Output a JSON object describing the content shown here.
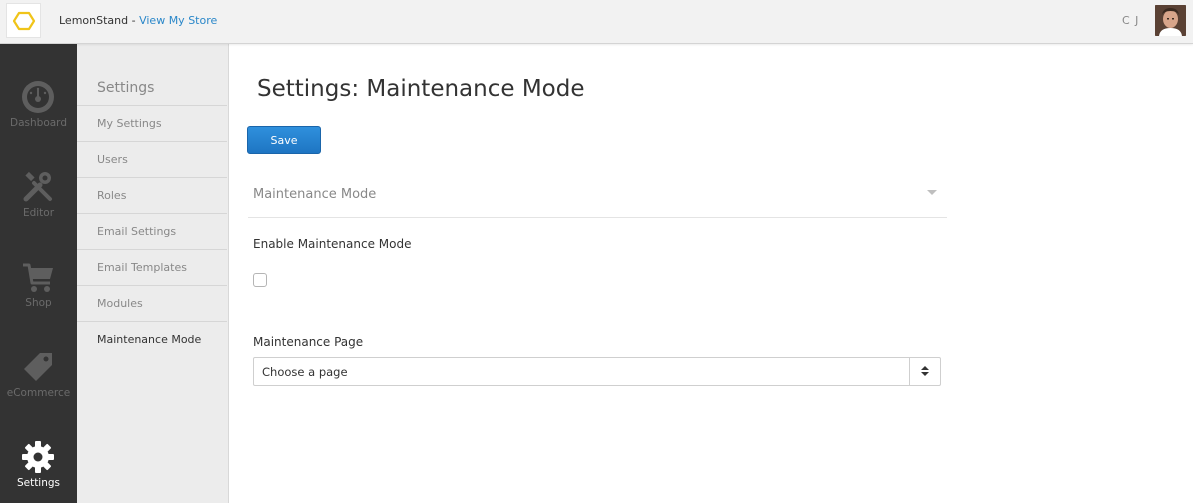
{
  "app": {
    "brand_name": "LemonStand",
    "brand_separator": " - ",
    "store_link": "View My Store",
    "user_initials": "C J",
    "accent_color": "#2a87c9",
    "logo_color": "#f0c419"
  },
  "left_nav": {
    "items": [
      {
        "label": "Dashboard",
        "icon": "speedometer-icon",
        "active": false
      },
      {
        "label": "Editor",
        "icon": "tools-icon",
        "active": false
      },
      {
        "label": "Shop",
        "icon": "cart-icon",
        "active": false
      },
      {
        "label": "eCommerce",
        "icon": "tag-icon",
        "active": false
      },
      {
        "label": "Settings",
        "icon": "gear-icon",
        "active": true
      }
    ]
  },
  "settings_nav": {
    "title": "Settings",
    "items": [
      {
        "label": "My Settings",
        "active": false
      },
      {
        "label": "Users",
        "active": false
      },
      {
        "label": "Roles",
        "active": false
      },
      {
        "label": "Email Settings",
        "active": false
      },
      {
        "label": "Email Templates",
        "active": false
      },
      {
        "label": "Modules",
        "active": false
      },
      {
        "label": "Maintenance Mode",
        "active": true
      }
    ]
  },
  "main": {
    "title": "Settings: Maintenance Mode",
    "save_label": "Save",
    "section_title": "Maintenance Mode",
    "enable_label": "Enable Maintenance Mode",
    "enable_checked": false,
    "page_label": "Maintenance Page",
    "page_select_value": "Choose a page"
  }
}
